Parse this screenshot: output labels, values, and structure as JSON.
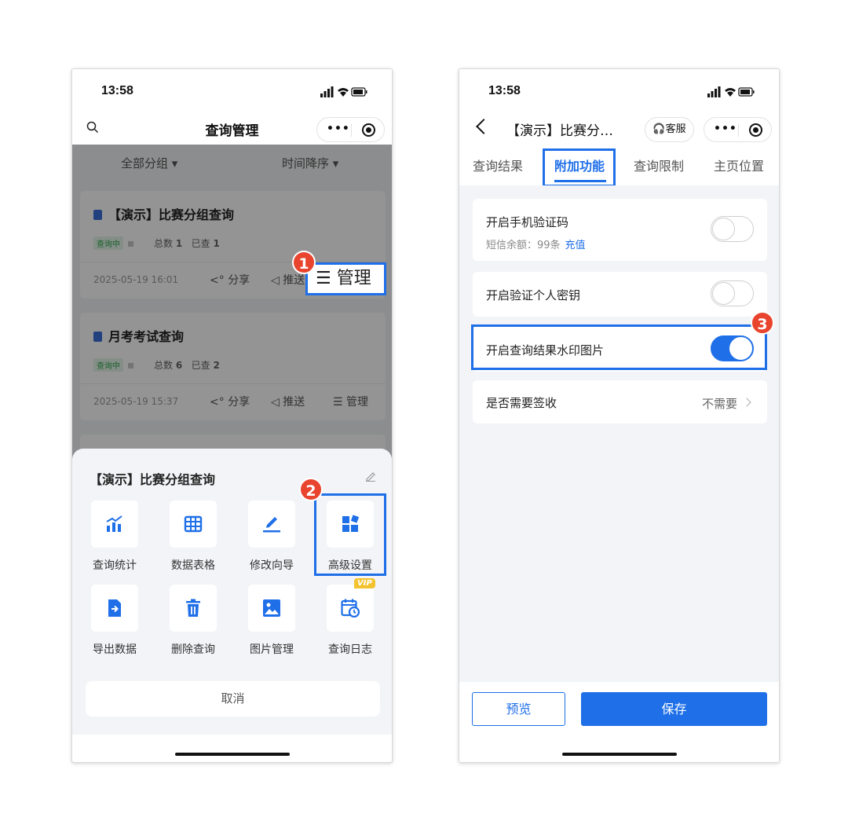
{
  "status": {
    "time": "13:58"
  },
  "left": {
    "title": "查询管理",
    "filters": [
      "全部分组 ▾",
      "时间降序 ▾"
    ],
    "cards": [
      {
        "title": "【演示】比赛分组查询",
        "tag": "查询中",
        "total_label": "总数",
        "total": "1",
        "checked_label": "已查",
        "checked": "1",
        "date": "2025-05-19 16:01",
        "share": "分享",
        "push": "推送",
        "manage": "管理"
      },
      {
        "title": "月考考试查询",
        "tag": "查询中",
        "total_label": "总数",
        "total": "6",
        "checked_label": "已查",
        "checked": "2",
        "date": "2025-05-19 15:37",
        "share": "分享",
        "push": "推送",
        "manage": "管理"
      }
    ],
    "manage_highlight": "☰ 管理",
    "sheet": {
      "title": "【演示】比赛分组查询",
      "items": [
        {
          "label": "查询统计",
          "icon": "chart-icon"
        },
        {
          "label": "数据表格",
          "icon": "table-icon"
        },
        {
          "label": "修改向导",
          "icon": "edit-icon"
        },
        {
          "label": "高级设置",
          "icon": "widgets-icon"
        },
        {
          "label": "导出数据",
          "icon": "export-icon"
        },
        {
          "label": "删除查询",
          "icon": "trash-icon"
        },
        {
          "label": "图片管理",
          "icon": "image-icon"
        },
        {
          "label": "查询日志",
          "icon": "calendar-icon",
          "badge": "VIP"
        }
      ],
      "cancel": "取消"
    },
    "badges": [
      "1",
      "2"
    ]
  },
  "right": {
    "title": "【演示】比赛分…",
    "kefu": "客服",
    "tabs": [
      "查询结果",
      "附加功能",
      "查询限制",
      "主页位置"
    ],
    "active_tab": 1,
    "rows": [
      {
        "label": "开启手机验证码",
        "sub": "短信余额：99条",
        "sub_link": "充值",
        "toggle": false
      },
      {
        "label": "开启验证个人密钥",
        "toggle": false
      },
      {
        "label": "开启查询结果水印图片",
        "toggle": true
      },
      {
        "label": "是否需要签收",
        "value": "不需要"
      }
    ],
    "preview": "预览",
    "save": "保存",
    "badge": "3"
  },
  "colors": {
    "accent": "#1e6fe8",
    "badge": "#e8442e",
    "tag_green": "#2ea54b",
    "vip": "#f3c32f"
  }
}
